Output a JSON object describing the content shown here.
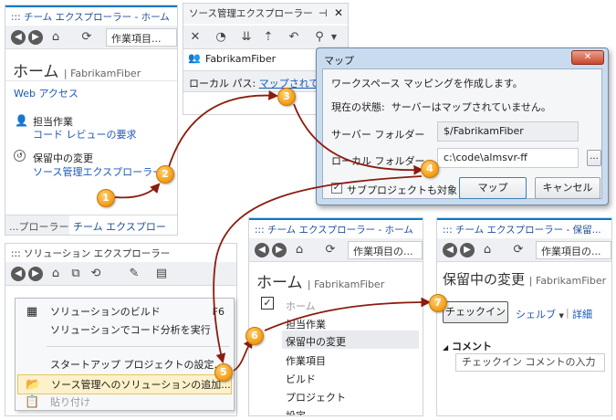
{
  "team_explorer_home": {
    "title": "::: チーム エクスプローラー - ホーム",
    "combo": "作業項目...",
    "heading": "ホーム",
    "project": "FabrikamFiber",
    "web_access": "Web アクセス",
    "assigned_work": "担当作業",
    "code_review": "コード レビューの要求",
    "pending_changes": "保留中の変更",
    "source_control_explorer": "ソース管理エクスプローラー",
    "tab_left": "...プローラー",
    "tab_active": "チーム エクスプローラー"
  },
  "source_control_explorer": {
    "title": "ソース管理エクスプローラー",
    "pin": "⊣",
    "close": "✕",
    "server": "FabrikamFiber",
    "local_path_label": "ローカル パス:",
    "local_path_link": "マップされて"
  },
  "map_dialog": {
    "title": "マップ",
    "close": "✕",
    "instruction": "ワークスペース マッピングを作成します。",
    "status": "現在の状態:  サーバーはマップされていません。",
    "server_folder_label": "サーバー フォルダー",
    "server_folder_value": "$/FabrikamFiber",
    "local_folder_label": "ローカル フォルダー",
    "local_folder_value": "c:\\code\\almsvr-ff",
    "browse": "...",
    "subprojects_label": "サブプロジェクトも対象",
    "map_button": "マップ",
    "cancel_button": "キャンセル"
  },
  "solution_explorer": {
    "title": "::: ソリューション エクスプローラー",
    "menu": [
      {
        "label": "ソリューションのビルド",
        "shortcut": "F6"
      },
      {
        "label": "ソリューションでコード分析を実行",
        "shortcut": ""
      },
      {
        "label": "スタートアップ プロジェクトの設定...",
        "shortcut": ""
      },
      {
        "label": "ソース管理へのソリューションの追加...",
        "shortcut": ""
      },
      {
        "label": "貼り付け",
        "shortcut": ""
      }
    ]
  },
  "team_explorer_home2": {
    "title": "::: チーム エクスプローラー - ホーム",
    "combo": "作業項目の...",
    "heading": "ホーム",
    "project": "FabrikamFiber",
    "nav": [
      "ホーム",
      "担当作業",
      "保留中の変更",
      "作業項目",
      "ビルド",
      "プロジェクト",
      "設定"
    ]
  },
  "team_explorer_pending": {
    "title": "::: チーム エクスプローラー - 保留...",
    "combo": "作業項目の...",
    "heading": "保留中の変更",
    "project": "FabrikamFiber",
    "checkin_button": "チェックイン",
    "shelve_link": "シェルブ",
    "details_link": "詳細",
    "comment_label": "コメント",
    "comment_placeholder": "チェックイン コメントの入力"
  },
  "steps": [
    "1",
    "2",
    "3",
    "4",
    "5",
    "6",
    "7"
  ],
  "colors": {
    "accent": "#007acc",
    "link": "#1c57b8",
    "arrow": "#8b1c0e",
    "bubble": "#f5a21b"
  }
}
